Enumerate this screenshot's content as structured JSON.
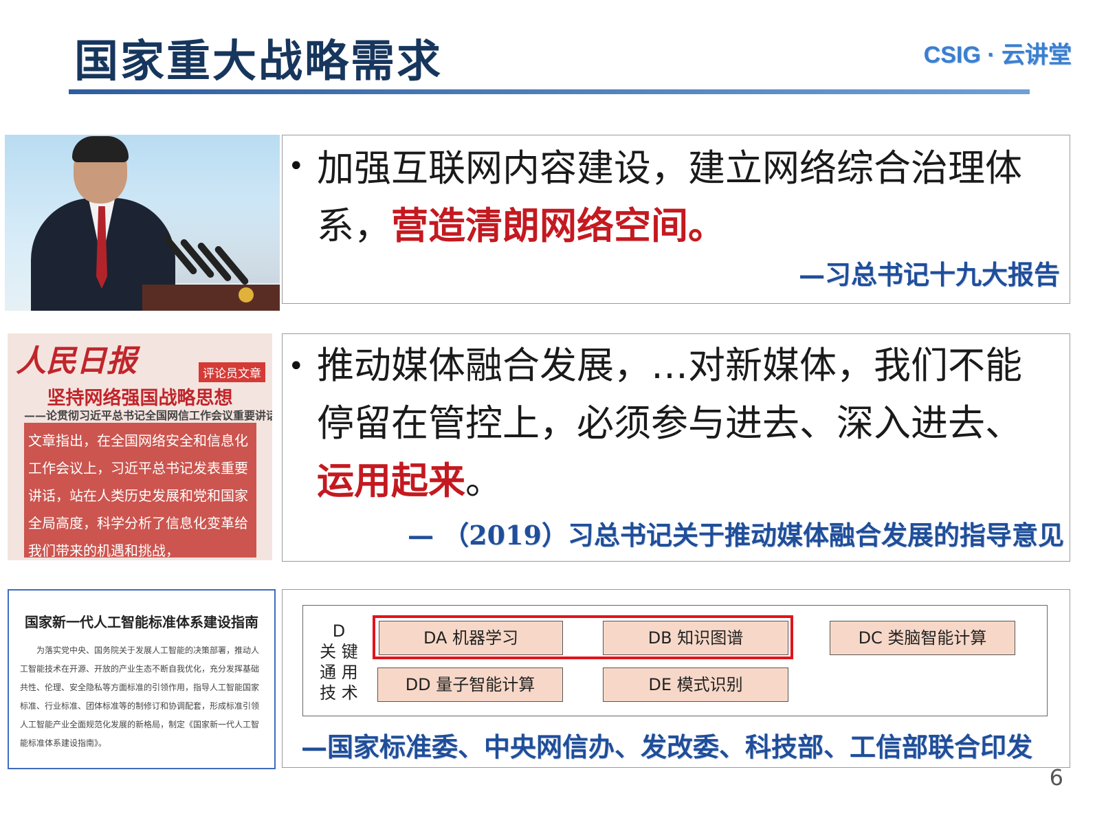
{
  "header": {
    "title": "国家重大战略需求",
    "logo": "CSIG · 云讲堂"
  },
  "row1": {
    "text_plain": "加强互联网内容建设，建立网络综合治理体",
    "text_plain2": "系，",
    "text_highlight": "营造清朗网络空间。",
    "source": "—习总书记十九大报告"
  },
  "row2": {
    "newspaper": {
      "masthead": "人民日报",
      "tag": "评论员文章",
      "headline": "坚持网络强国战略思想",
      "subline": "——论贯彻习近平总书记全国网信工作会议重要讲话",
      "body": "文章指出，在全国网络安全和信息化工作会议上，习近平总书记发表重要讲话，站在人类历史发展和党和国家全局高度，科学分析了信息化变革给我们带来的机遇和挑战，"
    },
    "line1": "推动媒体融合发展，…对新媒体，我们不能",
    "line2": "停留在管控上，必须参与进去、深入进去、",
    "text_highlight": "运用起来",
    "text_end": "。",
    "source": "— （2019）习总书记关于推动媒体融合发展的指导意见"
  },
  "row3": {
    "document": {
      "title": "国家新一代人工智能标准体系建设指南",
      "body": "为落实党中央、国务院关于发展人工智能的决策部署，推动人工智能技术在开源、开放的产业生态不断自我优化，充分发挥基础共性、伦理、安全隐私等方面标准的引领作用，指导人工智能国家标准、行业标准、团体标准等的制修订和协调配套，形成标准引领人工智能产业全面规范化发展的新格局，制定《国家新一代人工智能标准体系建设指南》。"
    },
    "diagram": {
      "label_letter": "D",
      "label_line1": "关 键",
      "label_line2": "通 用",
      "label_line3": "技 术",
      "boxes": [
        "DA 机器学习",
        "DB 知识图谱",
        "DC 类脑智能计算",
        "DD 量子智能计算",
        "DE 模式识别"
      ]
    },
    "source": "—国家标准委、中央网信办、发改委、科技部、工信部联合印发"
  },
  "page_number": "6",
  "colors": {
    "title": "#17365d",
    "highlight_red": "#c41920",
    "source_blue": "#1f4e9a",
    "box_fill": "#f7d8c8",
    "frame_red": "#e1141c"
  }
}
